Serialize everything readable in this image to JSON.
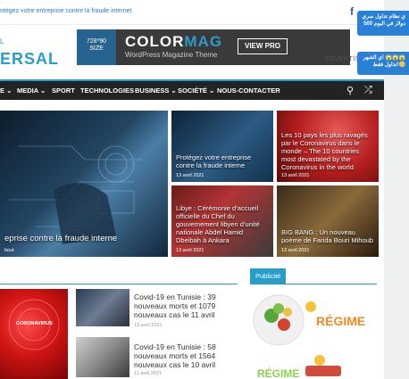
{
  "top": {
    "breaking": "otégez votre entreprise contre la fraude internet",
    "facebook_icon": "f"
  },
  "brand": {
    "logo_text": "ERSAL",
    "logo_prefix": "L"
  },
  "ads": {
    "size_label_1": "728*90",
    "size_label_2": "SIZE",
    "banner_title_a": "COLOR",
    "banner_title_b": "MAG",
    "banner_sub": "WordPress Magazine Theme",
    "banner_button": "VIEW PRO",
    "advertise": "ADVERTISE"
  },
  "popups": {
    "p1_line1": "ي نظام تداول سري",
    "p1_line2": "500 دولار في اليوم",
    "p2_line1": "ي الشهر! 😱😱😱",
    "p2_line2": "تداول فقط!🪙"
  },
  "nav": {
    "items": [
      "E ⌄",
      "MEDIA ⌄",
      "SPORT",
      "TECHNOLOGIES",
      "BUSINESS ⌄",
      "SOCIÉTÉ ⌄",
      "NOUS-CONTACTER"
    ],
    "search_icon": "⚲",
    "shuffle_icon": "⤮"
  },
  "featured": {
    "main_caption": "eprise contre la fraude interne",
    "main_date": "bout",
    "card1_caption": "Protégez votre entreprise contre la fraude interne",
    "card1_date": "13 avril 2021",
    "card2_caption": "Les 10 pays les plus ravagés par le Coronavirus dans le monde – The 10 countries most devastated by the Coronavirus in the world",
    "card2_date": "13 avril 2021",
    "card3_caption": "Libye : Cérémonie d’accueil officielle du Chef du gouvernement libyen d’unité nationale Abdel Hamid Dbeibah à Ankara",
    "card3_date": "13 avril 2021",
    "card4_caption": "BIG BANG : Un nouveau poème de Farida Bouri Mihoub",
    "card4_date": "13 avril 2021"
  },
  "news": {
    "corona_label": "CORONAVIRUS",
    "item1_title": "Covid-19 en Tunisie : 39 nouveaux morts et 1079 nouveaux cas le 11 avril",
    "item1_date": "13 avril 2021",
    "item2_title": "Covid-19 en Tunisie : 58 nouveaux morts et 1564 nouveaux cas le 10 avril",
    "item2_date": "11 avril 2021"
  },
  "sidebar": {
    "pub_label": "Publicité",
    "ad1_text": "RÉGIME",
    "ad2_text": "RÉGIME"
  }
}
